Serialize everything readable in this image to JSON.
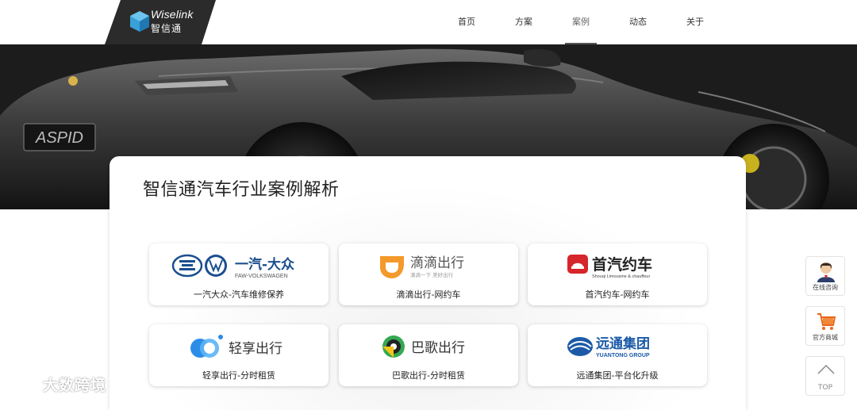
{
  "header": {
    "logo_en": "Wiselink",
    "logo_cn": "智信通",
    "nav": [
      {
        "label": "首页",
        "active": false
      },
      {
        "label": "方案",
        "active": false
      },
      {
        "label": "案例",
        "active": true
      },
      {
        "label": "动态",
        "active": false
      },
      {
        "label": "关于",
        "active": false
      }
    ]
  },
  "banner": {
    "plate_text": "ASPID"
  },
  "main": {
    "title": "智信通汽车行业案例解析",
    "cases": [
      {
        "logo_text": "一汽-大众",
        "logo_sub": "FAW-VOLKSWAGEN",
        "caption": "一汽大众-汽车维修保养"
      },
      {
        "logo_text": "滴滴出行",
        "logo_sub": "滴滴一下 美好出行",
        "caption": "滴滴出行-网约车"
      },
      {
        "logo_text": "首汽约车",
        "logo_sub": "Shouqi Limousine & chauffeur",
        "caption": "首汽约车-网约车"
      },
      {
        "logo_text": "轻享出行",
        "logo_sub": "",
        "caption": "轻享出行-分时租赁"
      },
      {
        "logo_text": "巴歌出行",
        "logo_sub": "",
        "caption": "巴歌出行-分时租赁"
      },
      {
        "logo_text": "远通集团",
        "logo_sub": "YUANTONG GROUP",
        "caption": "远通集团-平台化升级"
      }
    ]
  },
  "side": {
    "consult": "在线咨询",
    "shop": "官方商城",
    "top": "TOP"
  },
  "watermark": {
    "text": "大数跨境"
  },
  "colors": {
    "logo_plate": "#2b2b2b",
    "didi_orange": "#f39a2b",
    "shouqi_red": "#d6252b",
    "qingxiang_blue": "#2b8de8",
    "bage_green": "#35a853",
    "yuantong_blue": "#1c5aa8"
  }
}
